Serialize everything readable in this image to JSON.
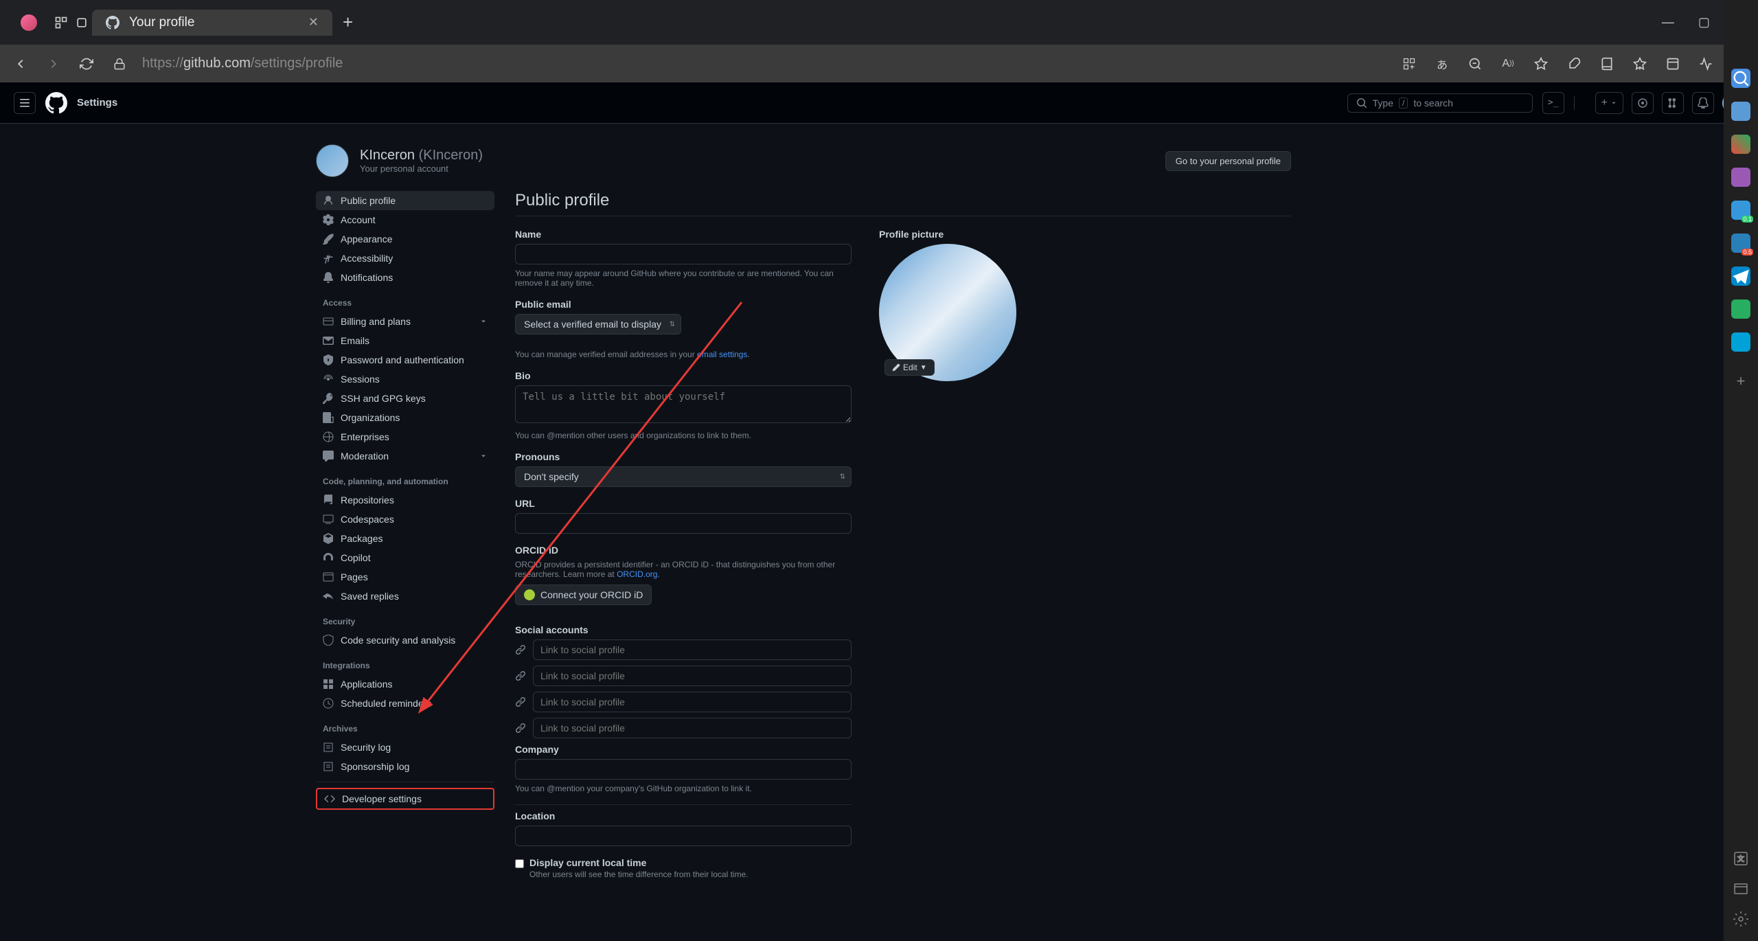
{
  "browser": {
    "tab_title": "Your profile",
    "url_prefix": "https://",
    "url_host": "github.com",
    "url_path": "/settings/profile"
  },
  "github_header": {
    "title": "Settings",
    "search_prefix": "Type",
    "search_key": "/",
    "search_suffix": "to search"
  },
  "profile": {
    "name": "KInceron",
    "handle": "(KInceron)",
    "subtitle": "Your personal account",
    "goto_label": "Go to your personal profile"
  },
  "sidebar": {
    "items1": [
      {
        "label": "Public profile"
      },
      {
        "label": "Account"
      },
      {
        "label": "Appearance"
      },
      {
        "label": "Accessibility"
      },
      {
        "label": "Notifications"
      }
    ],
    "section_access": "Access",
    "items2": [
      {
        "label": "Billing and plans"
      },
      {
        "label": "Emails"
      },
      {
        "label": "Password and authentication"
      },
      {
        "label": "Sessions"
      },
      {
        "label": "SSH and GPG keys"
      },
      {
        "label": "Organizations"
      },
      {
        "label": "Enterprises"
      },
      {
        "label": "Moderation"
      }
    ],
    "section_code": "Code, planning, and automation",
    "items3": [
      {
        "label": "Repositories"
      },
      {
        "label": "Codespaces"
      },
      {
        "label": "Packages"
      },
      {
        "label": "Copilot"
      },
      {
        "label": "Pages"
      },
      {
        "label": "Saved replies"
      }
    ],
    "section_security": "Security",
    "items4": [
      {
        "label": "Code security and analysis"
      }
    ],
    "section_integrations": "Integrations",
    "items5": [
      {
        "label": "Applications"
      },
      {
        "label": "Scheduled reminders"
      }
    ],
    "section_archives": "Archives",
    "items6": [
      {
        "label": "Security log"
      },
      {
        "label": "Sponsorship log"
      }
    ],
    "developer": "Developer settings"
  },
  "form": {
    "section_title": "Public profile",
    "name_label": "Name",
    "name_hint": "Your name may appear around GitHub where you contribute or are mentioned. You can remove it at any time.",
    "email_label": "Public email",
    "email_select": "Select a verified email to display",
    "email_hint_pre": "You can manage verified email addresses in your ",
    "email_hint_link": "email settings",
    "bio_label": "Bio",
    "bio_placeholder": "Tell us a little bit about yourself",
    "bio_hint": "You can @mention other users and organizations to link to them.",
    "pronouns_label": "Pronouns",
    "pronouns_select": "Don't specify",
    "url_label": "URL",
    "orcid_label": "ORCID iD",
    "orcid_hint_pre": "ORCID provides a persistent identifier - an ORCID iD - that distinguishes you from other researchers. Learn more at ",
    "orcid_hint_link": "ORCID.org",
    "orcid_btn": "Connect your ORCID iD",
    "social_label": "Social accounts",
    "social_placeholder": "Link to social profile",
    "company_label": "Company",
    "company_hint": "You can @mention your company's GitHub organization to link it.",
    "location_label": "Location",
    "tz_label": "Display current local time",
    "tz_hint": "Other users will see the time difference from their local time.",
    "pic_label": "Profile picture",
    "edit_label": "Edit"
  },
  "right_sidebar_badges": [
    "0.1",
    "0.5"
  ]
}
